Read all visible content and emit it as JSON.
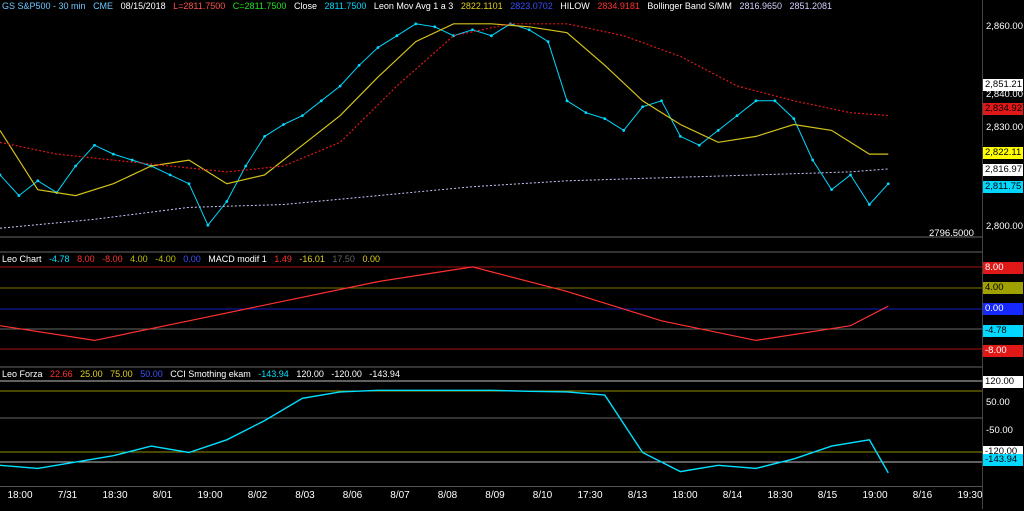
{
  "header": {
    "symbol": "GS S&P500 - 30 min",
    "exchange": "CME",
    "date": "08/15/2018",
    "low": "L=2811.7500",
    "close": "C=2811.7500",
    "close_label": "Close",
    "close_value": "2811.7500",
    "mov_avg_label": "Leon Mov Avg 1 a 3",
    "mov_avg_1": "2822.1101",
    "mov_avg_2": "2823.0702",
    "hilow_label": "HILOW",
    "hilow_value": "2834.9181",
    "bb_label": "Bollinger Band S/MM",
    "bb_1": "2816.9650",
    "bb_2": "2851.2081"
  },
  "leo_chart_header": {
    "label": "Leo Chart",
    "v1": "-4.78",
    "v2": "8.00",
    "v3": "-8.00",
    "v4": "4.00",
    "v5": "-4.00",
    "v6": "0.00",
    "macd_label": "MACD modif 1",
    "m1": "1.49",
    "m2": "-16.01",
    "m3": "17.50",
    "m4": "0.00"
  },
  "leo_forza_header": {
    "label": "Leo Forza",
    "v1": "22.66",
    "v2": "25.00",
    "v3": "75.00",
    "v4": "50.00",
    "cci_label": "CCI Smothing ekam",
    "c1": "-143.94",
    "c2": "120.00",
    "c3": "-120.00",
    "c4": "-143.94"
  },
  "price_axis": [
    "2,860.00",
    "2,851.21",
    "2,840.00",
    "2,834.92",
    "2,830.00",
    "2,822.11",
    "2,816.97",
    "2,811.75",
    "2,800.00"
  ],
  "price_level_label": "2796.5000",
  "osc1_axis": [
    "8.00",
    "4.00",
    "0.00",
    "-4.78",
    "-8.00"
  ],
  "osc2_axis": [
    "120.00",
    "50.00",
    "-50.00",
    "-120.00",
    "-143.94"
  ],
  "x_axis_labels": [
    "18:00",
    "7/31",
    "18:30",
    "8/01",
    "19:00",
    "8/02",
    "8/03",
    "8/06",
    "8/07",
    "8/08",
    "8/09",
    "8/10",
    "17:30",
    "8/13",
    "18:00",
    "8/14",
    "18:30",
    "8/15",
    "19:00",
    "8/16",
    "19:30"
  ],
  "colors": {
    "price": "#00d8ff",
    "ma_fast": "#d4c21c",
    "ma_slow": "#1428ff",
    "hilow": "#e01818",
    "bb_lower": "#c8c8ff",
    "bb_mid": "#20c020",
    "macd_line": "#ff3030",
    "signal": "#c0c000",
    "cci": "#00e0ff"
  },
  "chart_data": [
    {
      "type": "line",
      "title": "GS S&P500 - 30 min",
      "ylim": [
        2793,
        2870
      ],
      "x_range": [
        0,
        100
      ],
      "series": [
        {
          "name": "Close",
          "x": [
            0,
            2,
            4,
            6,
            8,
            10,
            12,
            14,
            16,
            18,
            20,
            22,
            24,
            26,
            28,
            30,
            32,
            34,
            36,
            38,
            40,
            42,
            44,
            46,
            48,
            50,
            52,
            54,
            56,
            58,
            60,
            62,
            64,
            66,
            68,
            70,
            72,
            74,
            76,
            78,
            80,
            82,
            84,
            86,
            88,
            90,
            92,
            94
          ],
          "values": [
            2815,
            2808,
            2813,
            2809,
            2818,
            2825,
            2822,
            2820,
            2818,
            2815,
            2812,
            2798,
            2806,
            2818,
            2828,
            2832,
            2835,
            2840,
            2845,
            2852,
            2858,
            2862,
            2866,
            2865,
            2862,
            2864,
            2862,
            2866,
            2864,
            2860,
            2840,
            2836,
            2834,
            2830,
            2838,
            2840,
            2828,
            2825,
            2830,
            2835,
            2840,
            2840,
            2834,
            2820,
            2810,
            2815,
            2805,
            2812
          ]
        },
        {
          "name": "Leon Mov Avg 1 a 3",
          "x": [
            0,
            4,
            8,
            12,
            16,
            20,
            24,
            28,
            32,
            36,
            40,
            44,
            48,
            52,
            56,
            60,
            64,
            68,
            72,
            76,
            80,
            84,
            88,
            92,
            94
          ],
          "values": [
            2830,
            2810,
            2808,
            2812,
            2818,
            2820,
            2812,
            2815,
            2825,
            2835,
            2848,
            2860,
            2866,
            2866,
            2865,
            2863,
            2852,
            2840,
            2832,
            2826,
            2828,
            2832,
            2830,
            2822,
            2822
          ]
        },
        {
          "name": "HILOW",
          "x": [
            0,
            6,
            12,
            18,
            24,
            30,
            36,
            42,
            48,
            54,
            60,
            66,
            72,
            78,
            84,
            90,
            94
          ],
          "values": [
            2826,
            2822,
            2820,
            2818,
            2816,
            2818,
            2826,
            2845,
            2862,
            2866,
            2866,
            2862,
            2855,
            2845,
            2840,
            2836,
            2835
          ]
        },
        {
          "name": "Bollinger Band S/MM",
          "x": [
            0,
            10,
            20,
            30,
            40,
            50,
            60,
            70,
            80,
            90,
            94
          ],
          "values": [
            2797,
            2800,
            2804,
            2805,
            2808,
            2811,
            2813,
            2814,
            2815,
            2816,
            2817
          ]
        }
      ]
    },
    {
      "type": "line",
      "title": "Leo Chart",
      "ylim": [
        -10,
        10
      ],
      "series": [
        {
          "name": "MACD modif 1",
          "x": [
            0,
            10,
            20,
            30,
            40,
            50,
            60,
            70,
            80,
            90,
            94
          ],
          "values": [
            -3,
            -6,
            -2,
            2,
            6,
            9,
            4,
            -2,
            -6,
            -3,
            1
          ]
        }
      ]
    },
    {
      "type": "line",
      "title": "Leo Forza",
      "ylim": [
        -160,
        160
      ],
      "series": [
        {
          "name": "CCI Smothing ekam",
          "x": [
            0,
            4,
            8,
            12,
            16,
            20,
            24,
            28,
            32,
            36,
            40,
            44,
            48,
            52,
            56,
            60,
            64,
            68,
            72,
            76,
            80,
            84,
            88,
            92,
            94
          ],
          "values": [
            -120,
            -130,
            -110,
            -90,
            -60,
            -80,
            -40,
            20,
            90,
            110,
            115,
            115,
            115,
            115,
            112,
            110,
            100,
            -80,
            -140,
            -120,
            -130,
            -100,
            -60,
            -40,
            -144
          ]
        }
      ]
    }
  ]
}
